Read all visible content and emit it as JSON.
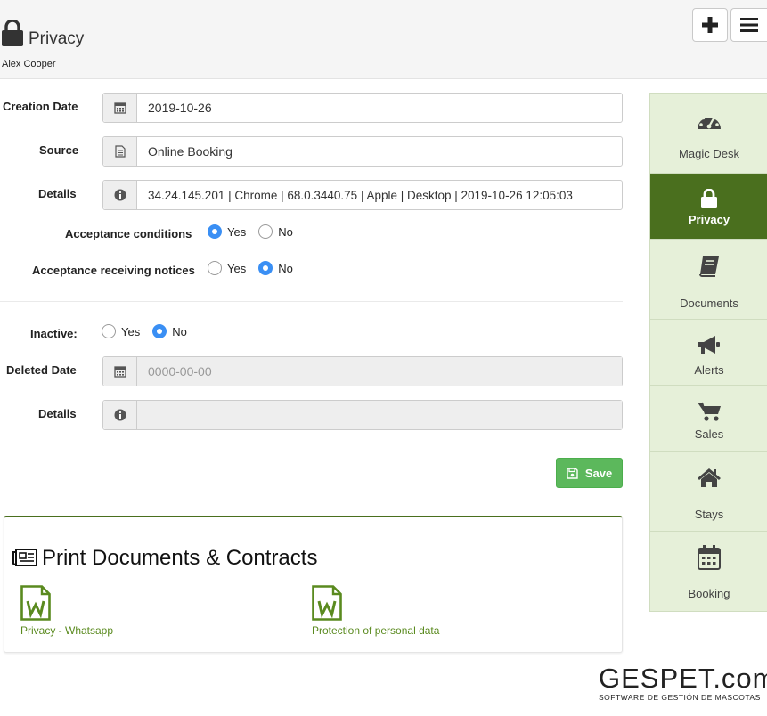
{
  "header": {
    "title": "Privacy",
    "user": "Alex Cooper",
    "add_icon": "plus-icon",
    "menu_icon": "hamburger-icon"
  },
  "form": {
    "creation_date": {
      "label": "Creation Date",
      "value": "2019-10-26",
      "icon": "calendar-icon"
    },
    "source": {
      "label": "Source",
      "value": "Online Booking",
      "icon": "file-icon"
    },
    "details": {
      "label": "Details",
      "value": "34.24.145.201 | Chrome | 68.0.3440.75 | Apple | Desktop | 2019-10-26 12:05:03",
      "icon": "info-icon"
    },
    "acceptance_conditions": {
      "label": "Acceptance conditions",
      "yes": "Yes",
      "no": "No",
      "selected": "yes"
    },
    "acceptance_notices": {
      "label": "Acceptance receiving notices",
      "yes": "Yes",
      "no": "No",
      "selected": "no"
    },
    "inactive": {
      "label": "Inactive:",
      "yes": "Yes",
      "no": "No",
      "selected": "no"
    },
    "deleted_date": {
      "label": "Deleted Date",
      "placeholder": "0000-00-00",
      "icon": "calendar-icon"
    },
    "details2": {
      "label": "Details",
      "value": "",
      "icon": "info-icon"
    },
    "save_label": "Save"
  },
  "print": {
    "title": "Print Documents & Contracts",
    "documents": [
      {
        "label": "Privacy - Whatsapp",
        "icon": "word-document-icon"
      },
      {
        "label": "Protection of personal data",
        "icon": "word-document-icon"
      }
    ]
  },
  "sidebar": {
    "items": [
      {
        "label": "Magic Desk",
        "icon": "dashboard-icon",
        "active": false
      },
      {
        "label": "Privacy",
        "icon": "lock-icon",
        "active": true
      },
      {
        "label": "Documents",
        "icon": "book-icon",
        "active": false
      },
      {
        "label": "Alerts",
        "icon": "megaphone-icon",
        "active": false
      },
      {
        "label": "Sales",
        "icon": "cart-icon",
        "active": false
      },
      {
        "label": "Stays",
        "icon": "home-icon",
        "active": false
      },
      {
        "label": "Booking",
        "icon": "calendar-icon",
        "active": false
      }
    ]
  },
  "logo": {
    "brand": "GESPET.com",
    "tagline": "SOFTWARE DE GESTIÓN DE MASCOTAS"
  },
  "colors": {
    "accent_green": "#4a6f1e",
    "sidebar_bg": "#e6f0d9",
    "save_green": "#5cb85c",
    "radio_blue": "#3a8ff4",
    "link_green": "#5a8a1f"
  }
}
